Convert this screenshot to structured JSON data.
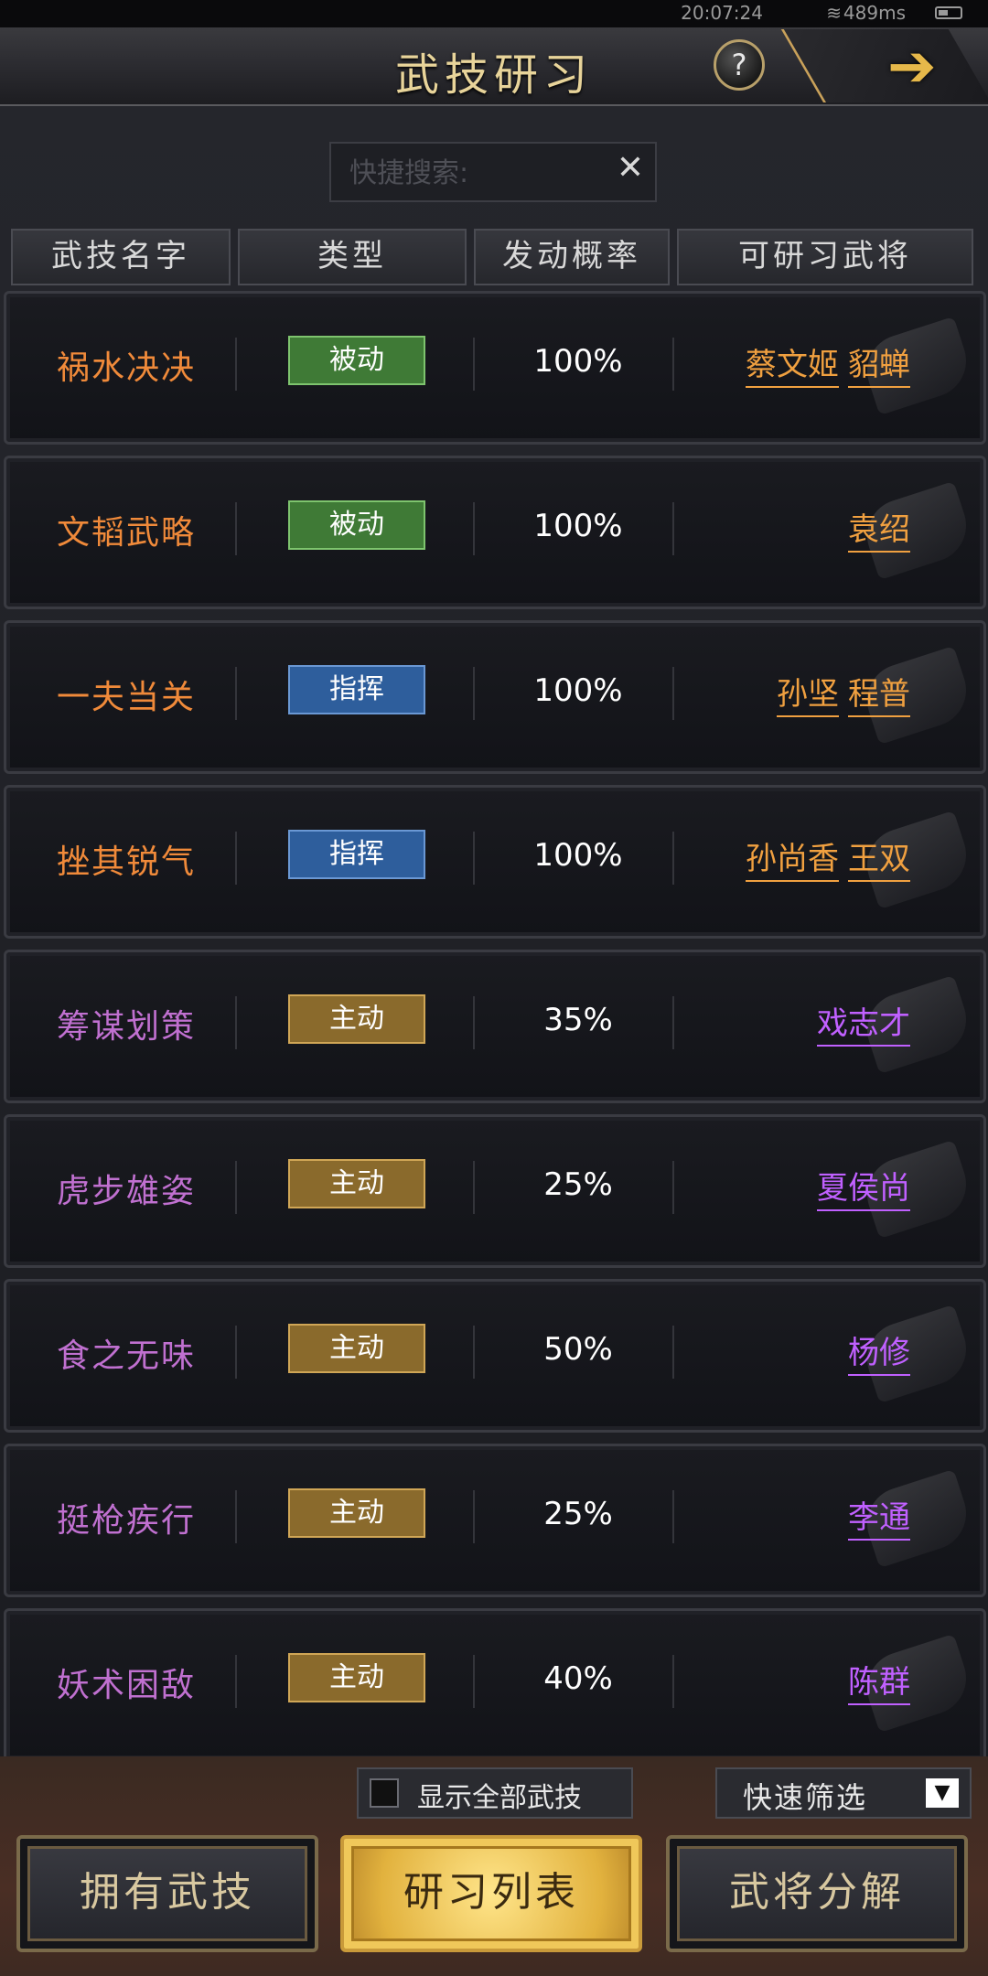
{
  "status": {
    "time": "20:07:24",
    "ping": "489ms"
  },
  "header": {
    "title": "武技研习",
    "help_label": "?"
  },
  "search": {
    "placeholder": "快捷搜索:",
    "clear_label": "✕"
  },
  "table": {
    "headers": [
      "武技名字",
      "类型",
      "发动概率",
      "可研习武将"
    ],
    "rows": [
      {
        "name": "祸水决决",
        "name_color": "#f08a3a",
        "type": "被动",
        "type_kind": "passive",
        "rate": "100%",
        "generals": [
          "蔡文姬",
          "貂蝉"
        ],
        "generals_color": "#f0a040"
      },
      {
        "name": "文韬武略",
        "name_color": "#f08a3a",
        "type": "被动",
        "type_kind": "passive",
        "rate": "100%",
        "generals": [
          "袁绍"
        ],
        "generals_color": "#f0a040"
      },
      {
        "name": "一夫当关",
        "name_color": "#f08a3a",
        "type": "指挥",
        "type_kind": "command",
        "rate": "100%",
        "generals": [
          "孙坚",
          "程普"
        ],
        "generals_color": "#f0a040"
      },
      {
        "name": "挫其锐气",
        "name_color": "#f08a3a",
        "type": "指挥",
        "type_kind": "command",
        "rate": "100%",
        "generals": [
          "孙尚香",
          "王双"
        ],
        "generals_color": "#f0a040"
      },
      {
        "name": "筹谋划策",
        "name_color": "#c070d0",
        "type": "主动",
        "type_kind": "active",
        "rate": "35%",
        "generals": [
          "戏志才"
        ],
        "generals_color": "#c060ff"
      },
      {
        "name": "虎步雄姿",
        "name_color": "#c070d0",
        "type": "主动",
        "type_kind": "active",
        "rate": "25%",
        "generals": [
          "夏侯尚"
        ],
        "generals_color": "#c060ff"
      },
      {
        "name": "食之无味",
        "name_color": "#c070d0",
        "type": "主动",
        "type_kind": "active",
        "rate": "50%",
        "generals": [
          "杨修"
        ],
        "generals_color": "#c060ff"
      },
      {
        "name": "挺枪疾行",
        "name_color": "#c070d0",
        "type": "主动",
        "type_kind": "active",
        "rate": "25%",
        "generals": [
          "李通"
        ],
        "generals_color": "#c060ff"
      },
      {
        "name": "妖术困敌",
        "name_color": "#c070d0",
        "type": "主动",
        "type_kind": "active",
        "rate": "40%",
        "generals": [
          "陈群"
        ],
        "generals_color": "#c060ff"
      }
    ]
  },
  "footer": {
    "show_all_label": "显示全部武技",
    "show_all_checked": false,
    "filter_label": "快速筛选",
    "tabs": [
      {
        "label": "拥有武技",
        "active": false
      },
      {
        "label": "研习列表",
        "active": true
      },
      {
        "label": "武将分解",
        "active": false
      }
    ]
  }
}
